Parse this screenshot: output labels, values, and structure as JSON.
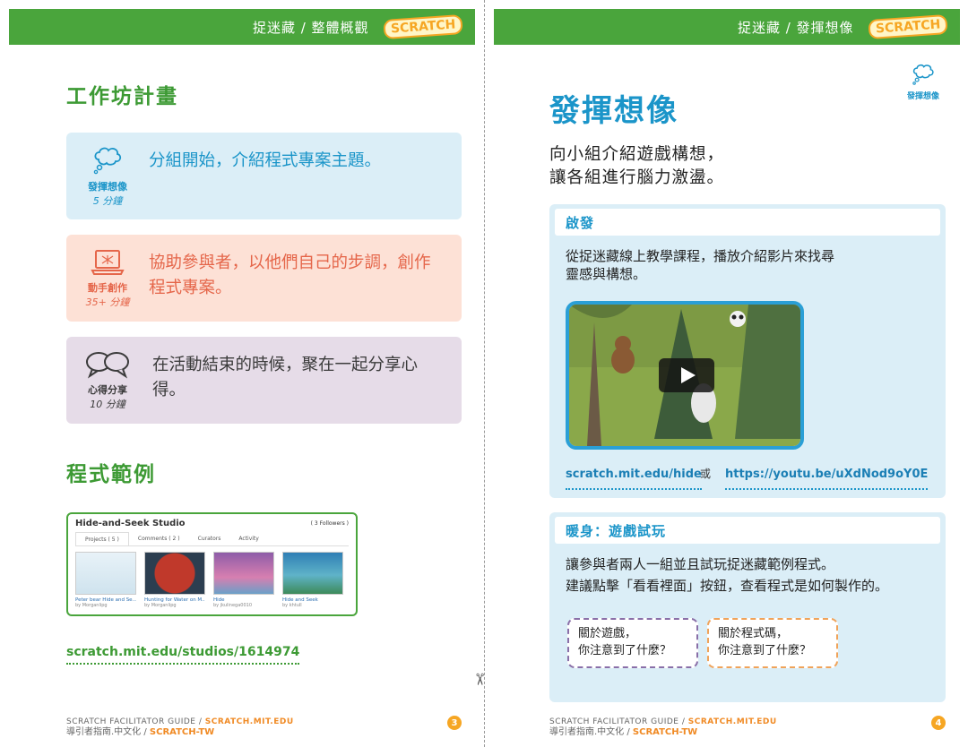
{
  "left_page": {
    "header": {
      "breadcrumb": "捉迷藏 / 整體概觀",
      "logo_text": "SCRATCH"
    },
    "workshop_title": "工作坊計畫",
    "cards": [
      {
        "icon": "thought-cloud-icon",
        "name": "發揮想像",
        "duration": "5 分鐘",
        "text": "分組開始，介紹程式專案主題。"
      },
      {
        "icon": "laptop-icon",
        "name": "動手創作",
        "duration": "35+ 分鐘",
        "text": "協助參與者，以他們自己的步調，創作程式專案。"
      },
      {
        "icon": "speech-bubbles-icon",
        "name": "心得分享",
        "duration": "10 分鐘",
        "text": "在活動結束的時候，聚在一起分享心得。"
      }
    ],
    "examples_title": "程式範例",
    "studio": {
      "title": "Hide-and-Seek Studio",
      "followers": "( 3 Followers )",
      "tabs": [
        "Projects ( 5 )",
        "Comments ( 2 )",
        "Curators",
        "Activity"
      ],
      "projects": [
        {
          "title": "Peter bear Hide and Se...",
          "by": "by Morganlipg"
        },
        {
          "title": "Hunting for Water on M...",
          "by": "by Morganlipg"
        },
        {
          "title": "Hide",
          "by": "by jkulinega0010"
        },
        {
          "title": "Hide and Seek",
          "by": "by khtull"
        }
      ]
    },
    "studio_link": "scratch.mit.edu/studios/1614974",
    "footer": {
      "line1_a": "SCRATCH FACILITATOR GUIDE / ",
      "line1_b": "SCRATCH.MIT.EDU",
      "line2_a": "導引者指南.中文化 / ",
      "line2_b": "SCRATCH-TW"
    },
    "page_number": "3"
  },
  "right_page": {
    "header": {
      "breadcrumb": "捉迷藏 / 發揮想像",
      "logo_text": "SCRATCH"
    },
    "title": "發揮想像",
    "corner_label": "發揮想像",
    "intro_line1": "向小組介紹遊戲構想，",
    "intro_line2": "讓各組進行腦力激盪。",
    "inspire": {
      "tag": "啟發",
      "text_line1": "從捉迷藏線上教學課程，播放介紹影片來找尋",
      "text_line2": "靈感與構想。",
      "link1": "scratch.mit.edu/hide",
      "or": "或",
      "link2": "https://youtu.be/uXdNod9oY0E"
    },
    "warmup": {
      "tag": "暖身：遊戲試玩",
      "text_line1": "讓參與者兩人一組並且試玩捉迷藏範例程式。",
      "text_line2": "建議點擊「看看裡面」按鈕，查看程式是如何製作的。",
      "bubble1_line1": "關於遊戲，",
      "bubble1_line2": "你注意到了什麼？",
      "bubble2_line1": "關於程式碼，",
      "bubble2_line2": "你注意到了什麼？"
    },
    "footer": {
      "line1_a": "SCRATCH FACILITATOR GUIDE / ",
      "line1_b": "SCRATCH.MIT.EDU",
      "line2_a": "導引者指南.中文化 / ",
      "line2_b": "SCRATCH-TW"
    },
    "page_number": "4"
  },
  "colors": {
    "green": "#4aa53c",
    "blue": "#1b95c9",
    "orange": "#e5664a",
    "light_blue_bg": "#dbeef7"
  }
}
